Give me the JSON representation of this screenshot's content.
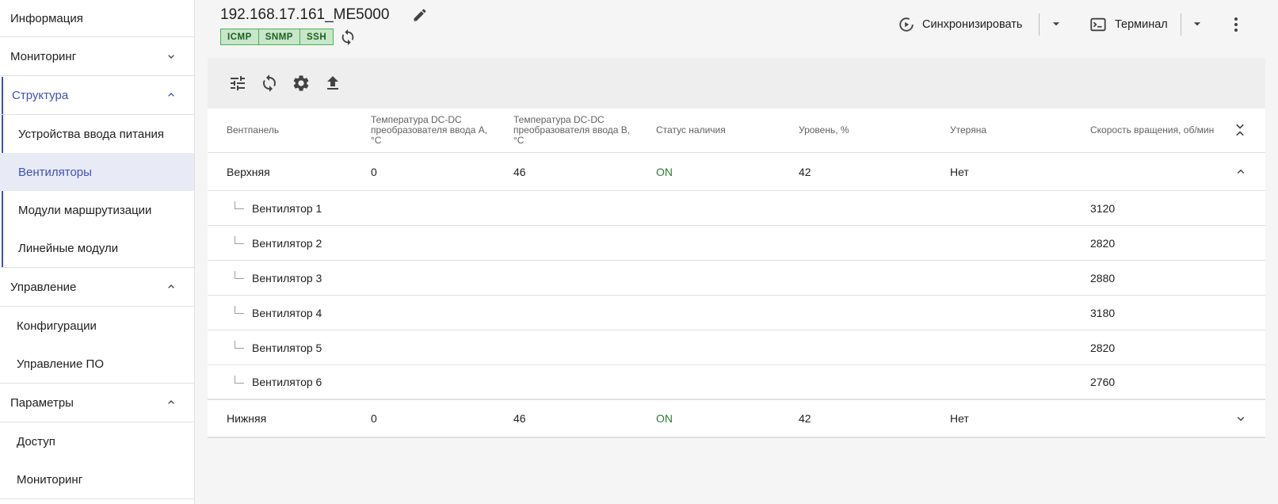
{
  "sidebar": {
    "items": [
      {
        "label": "Информация"
      },
      {
        "label": "Мониторинг"
      },
      {
        "label": "Структура"
      },
      {
        "label": "Устройства ввода питания"
      },
      {
        "label": "Вентиляторы"
      },
      {
        "label": "Модули маршрутизации"
      },
      {
        "label": "Линейные модули"
      },
      {
        "label": "Управление"
      },
      {
        "label": "Конфигурации"
      },
      {
        "label": "Управление ПО"
      },
      {
        "label": "Параметры"
      },
      {
        "label": "Доступ"
      },
      {
        "label": "Мониторинг"
      }
    ]
  },
  "header": {
    "title": "192.168.17.161_ME5000",
    "badges": [
      "ICMP",
      "SNMP",
      "SSH"
    ],
    "sync_label": "Синхронизировать",
    "terminal_label": "Терминал"
  },
  "table": {
    "columns": [
      "Вентпанель",
      "Температура DC-DC преобразователя ввода A, °C",
      "Температура DC-DC преобразователя ввода B, °C",
      "Статус наличия",
      "Уровень, %",
      "Утеряна",
      "Скорость вращения, об/мин"
    ],
    "panels": [
      {
        "name": "Верхняя",
        "temp_a": "0",
        "temp_b": "46",
        "status": "ON",
        "level": "42",
        "lost": "Нет",
        "fans": [
          {
            "name": "Вентилятор 1",
            "speed": "3120"
          },
          {
            "name": "Вентилятор 2",
            "speed": "2820"
          },
          {
            "name": "Вентилятор 3",
            "speed": "2880"
          },
          {
            "name": "Вентилятор 4",
            "speed": "3180"
          },
          {
            "name": "Вентилятор 5",
            "speed": "2820"
          },
          {
            "name": "Вентилятор 6",
            "speed": "2760"
          }
        ]
      },
      {
        "name": "Нижняя",
        "temp_a": "0",
        "temp_b": "46",
        "status": "ON",
        "level": "42",
        "lost": "Нет"
      }
    ]
  },
  "colors": {
    "accent": "#3f51b5",
    "status_on": "#2e7d32",
    "badge_bg": "#c8e6c9"
  }
}
